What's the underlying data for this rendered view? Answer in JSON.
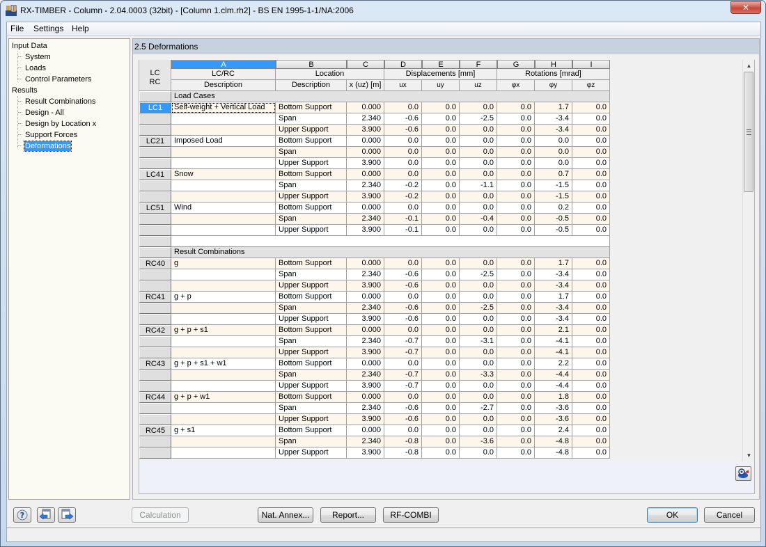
{
  "window": {
    "title": "RX-TIMBER - Column - 2.04.0003 (32bit) - [Column 1.clm.rh2] - BS EN 1995-1-1/NA:2006",
    "close_label": "✕"
  },
  "menu": [
    "File",
    "Settings",
    "Help"
  ],
  "tree": {
    "groups": [
      {
        "label": "Input Data",
        "items": [
          "System",
          "Loads",
          "Control Parameters"
        ]
      },
      {
        "label": "Results",
        "items": [
          "Result Combinations",
          "Design - All",
          "Design by Location x",
          "Support Forces",
          "Deformations"
        ]
      }
    ],
    "selected": "Deformations"
  },
  "panel": {
    "title": "2.5 Deformations"
  },
  "grid": {
    "corner": [
      "LC",
      "RC"
    ],
    "column_letters": [
      "A",
      "B",
      "C",
      "D",
      "E",
      "F",
      "G",
      "H",
      "I"
    ],
    "group_headers": {
      "lcrc": "LC/RC",
      "location": "Location",
      "displacements": "Displacements [mm]",
      "rotations": "Rotations [mrad]"
    },
    "sub_headers": [
      "Description",
      "Description",
      "x (uz) [m]",
      "ux",
      "uy",
      "uz",
      "φx",
      "φy",
      "φz"
    ],
    "sections": [
      {
        "title": "Load Cases",
        "cases": [
          {
            "id": "LC1",
            "description": "Self-weight + Vertical Load",
            "rows": [
              [
                "Bottom Support",
                "0.000",
                "0.0",
                "0.0",
                "0.0",
                "0.0",
                "1.7",
                "0.0"
              ],
              [
                "Span",
                "2.340",
                "-0.6",
                "0.0",
                "-2.5",
                "0.0",
                "-3.4",
                "0.0"
              ],
              [
                "Upper Support",
                "3.900",
                "-0.6",
                "0.0",
                "0.0",
                "0.0",
                "-3.4",
                "0.0"
              ]
            ]
          },
          {
            "id": "LC21",
            "description": "Imposed Load",
            "rows": [
              [
                "Bottom Support",
                "0.000",
                "0.0",
                "0.0",
                "0.0",
                "0.0",
                "0.0",
                "0.0"
              ],
              [
                "Span",
                "0.000",
                "0.0",
                "0.0",
                "0.0",
                "0.0",
                "0.0",
                "0.0"
              ],
              [
                "Upper Support",
                "3.900",
                "0.0",
                "0.0",
                "0.0",
                "0.0",
                "0.0",
                "0.0"
              ]
            ]
          },
          {
            "id": "LC41",
            "description": "Snow",
            "rows": [
              [
                "Bottom Support",
                "0.000",
                "0.0",
                "0.0",
                "0.0",
                "0.0",
                "0.7",
                "0.0"
              ],
              [
                "Span",
                "2.340",
                "-0.2",
                "0.0",
                "-1.1",
                "0.0",
                "-1.5",
                "0.0"
              ],
              [
                "Upper Support",
                "3.900",
                "-0.2",
                "0.0",
                "0.0",
                "0.0",
                "-1.5",
                "0.0"
              ]
            ]
          },
          {
            "id": "LC51",
            "description": "Wind",
            "rows": [
              [
                "Bottom Support",
                "0.000",
                "0.0",
                "0.0",
                "0.0",
                "0.0",
                "0.2",
                "0.0"
              ],
              [
                "Span",
                "2.340",
                "-0.1",
                "0.0",
                "-0.4",
                "0.0",
                "-0.5",
                "0.0"
              ],
              [
                "Upper Support",
                "3.900",
                "-0.1",
                "0.0",
                "0.0",
                "0.0",
                "-0.5",
                "0.0"
              ]
            ]
          }
        ]
      },
      {
        "title": "Result Combinations",
        "cases": [
          {
            "id": "RC40",
            "description": "g",
            "rows": [
              [
                "Bottom Support",
                "0.000",
                "0.0",
                "0.0",
                "0.0",
                "0.0",
                "1.7",
                "0.0"
              ],
              [
                "Span",
                "2.340",
                "-0.6",
                "0.0",
                "-2.5",
                "0.0",
                "-3.4",
                "0.0"
              ],
              [
                "Upper Support",
                "3.900",
                "-0.6",
                "0.0",
                "0.0",
                "0.0",
                "-3.4",
                "0.0"
              ]
            ]
          },
          {
            "id": "RC41",
            "description": "g + p",
            "rows": [
              [
                "Bottom Support",
                "0.000",
                "0.0",
                "0.0",
                "0.0",
                "0.0",
                "1.7",
                "0.0"
              ],
              [
                "Span",
                "2.340",
                "-0.6",
                "0.0",
                "-2.5",
                "0.0",
                "-3.4",
                "0.0"
              ],
              [
                "Upper Support",
                "3.900",
                "-0.6",
                "0.0",
                "0.0",
                "0.0",
                "-3.4",
                "0.0"
              ]
            ]
          },
          {
            "id": "RC42",
            "description": "g + p + s1",
            "rows": [
              [
                "Bottom Support",
                "0.000",
                "0.0",
                "0.0",
                "0.0",
                "0.0",
                "2.1",
                "0.0"
              ],
              [
                "Span",
                "2.340",
                "-0.7",
                "0.0",
                "-3.1",
                "0.0",
                "-4.1",
                "0.0"
              ],
              [
                "Upper Support",
                "3.900",
                "-0.7",
                "0.0",
                "0.0",
                "0.0",
                "-4.1",
                "0.0"
              ]
            ]
          },
          {
            "id": "RC43",
            "description": "g + p + s1 + w1",
            "rows": [
              [
                "Bottom Support",
                "0.000",
                "0.0",
                "0.0",
                "0.0",
                "0.0",
                "2.2",
                "0.0"
              ],
              [
                "Span",
                "2.340",
                "-0.7",
                "0.0",
                "-3.3",
                "0.0",
                "-4.4",
                "0.0"
              ],
              [
                "Upper Support",
                "3.900",
                "-0.7",
                "0.0",
                "0.0",
                "0.0",
                "-4.4",
                "0.0"
              ]
            ]
          },
          {
            "id": "RC44",
            "description": "g + p + w1",
            "rows": [
              [
                "Bottom Support",
                "0.000",
                "0.0",
                "0.0",
                "0.0",
                "0.0",
                "1.8",
                "0.0"
              ],
              [
                "Span",
                "2.340",
                "-0.6",
                "0.0",
                "-2.7",
                "0.0",
                "-3.6",
                "0.0"
              ],
              [
                "Upper Support",
                "3.900",
                "-0.6",
                "0.0",
                "0.0",
                "0.0",
                "-3.6",
                "0.0"
              ]
            ]
          },
          {
            "id": "RC45",
            "description": "g + s1",
            "rows": [
              [
                "Bottom Support",
                "0.000",
                "0.0",
                "0.0",
                "0.0",
                "0.0",
                "2.4",
                "0.0"
              ],
              [
                "Span",
                "2.340",
                "-0.8",
                "0.0",
                "-3.6",
                "0.0",
                "-4.8",
                "0.0"
              ],
              [
                "Upper Support",
                "3.900",
                "-0.8",
                "0.0",
                "0.0",
                "0.0",
                "-4.8",
                "0.0"
              ]
            ]
          }
        ]
      }
    ],
    "selected_case": "LC1"
  },
  "buttons": {
    "calculation": "Calculation",
    "nat_annex": "Nat. Annex...",
    "report": "Report...",
    "rf_combi": "RF-COMBI",
    "ok": "OK",
    "cancel": "Cancel"
  },
  "icons": {
    "help": "help-icon",
    "previous": "previous-window-icon",
    "next": "next-window-icon",
    "export": "export-view-icon"
  },
  "colors": {
    "selection": "#3399ff",
    "row_stripe": "#fdf7eb",
    "panel_header": "#c7d2de",
    "tree_background": "#fbfaf3"
  }
}
